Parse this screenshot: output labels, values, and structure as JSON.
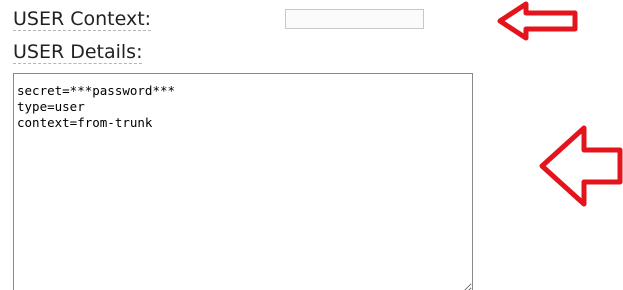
{
  "form": {
    "context_label": "USER Context:",
    "context_value": "",
    "details_label": "USER Details:",
    "details_value": "secret=***password***\ntype=user\ncontext=from-trunk"
  },
  "annotations": {
    "arrow_color": "#e3141b",
    "arrow_icon": "left-arrow-icon"
  }
}
